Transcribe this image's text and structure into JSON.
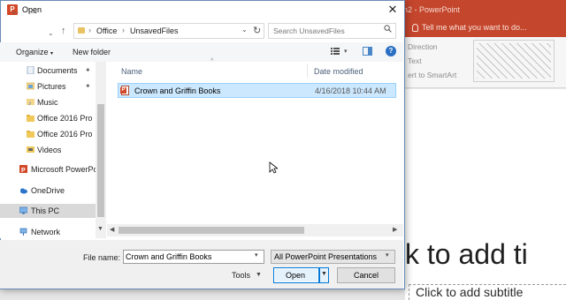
{
  "powerpoint": {
    "window_title": "n2 - PowerPoint",
    "tell_me": "Tell me what you want to do...",
    "ribbon_items": [
      "Direction",
      "Text",
      "ert to SmartArt"
    ],
    "slide_title": "k to add ti",
    "slide_subtitle": "Click to add subtitle"
  },
  "dialog": {
    "title": "Open",
    "breadcrumb": [
      "Office",
      "UnsavedFiles"
    ],
    "search_placeholder": "Search UnsavedFiles",
    "toolbar": {
      "organize": "Organize",
      "new_folder": "New folder"
    },
    "nav_items": [
      {
        "label": "Documents",
        "icon": "documents-icon",
        "pinned": true
      },
      {
        "label": "Pictures",
        "icon": "pictures-icon",
        "pinned": true
      },
      {
        "label": "Music",
        "icon": "music-icon",
        "pinned": false
      },
      {
        "label": "Office 2016 Pro",
        "icon": "folder-icon",
        "pinned": false
      },
      {
        "label": "Office 2016 Pro",
        "icon": "folder-icon",
        "pinned": false
      },
      {
        "label": "Videos",
        "icon": "videos-icon",
        "pinned": false
      },
      {
        "label": "Microsoft PowerPo",
        "icon": "powerpoint-icon",
        "pinned": false
      },
      {
        "label": "OneDrive",
        "icon": "onedrive-icon",
        "pinned": false
      },
      {
        "label": "This PC",
        "icon": "this-pc-icon",
        "pinned": false,
        "selected": true
      },
      {
        "label": "Network",
        "icon": "network-icon",
        "pinned": false
      }
    ],
    "columns": {
      "name": "Name",
      "date_modified": "Date modified"
    },
    "files": [
      {
        "name": "Crown and Griffin Books",
        "date_modified": "4/16/2018 10:44 AM",
        "selected": true
      }
    ],
    "file_name_label": "File name:",
    "file_name_value": "Crown and Griffin Books",
    "file_type": "All PowerPoint Presentations",
    "tools_label": "Tools",
    "open_label": "Open",
    "cancel_label": "Cancel"
  },
  "colors": {
    "ppt_accent": "#c4462c",
    "selection": "#cce8ff",
    "primary_button_border": "#0078d7"
  }
}
